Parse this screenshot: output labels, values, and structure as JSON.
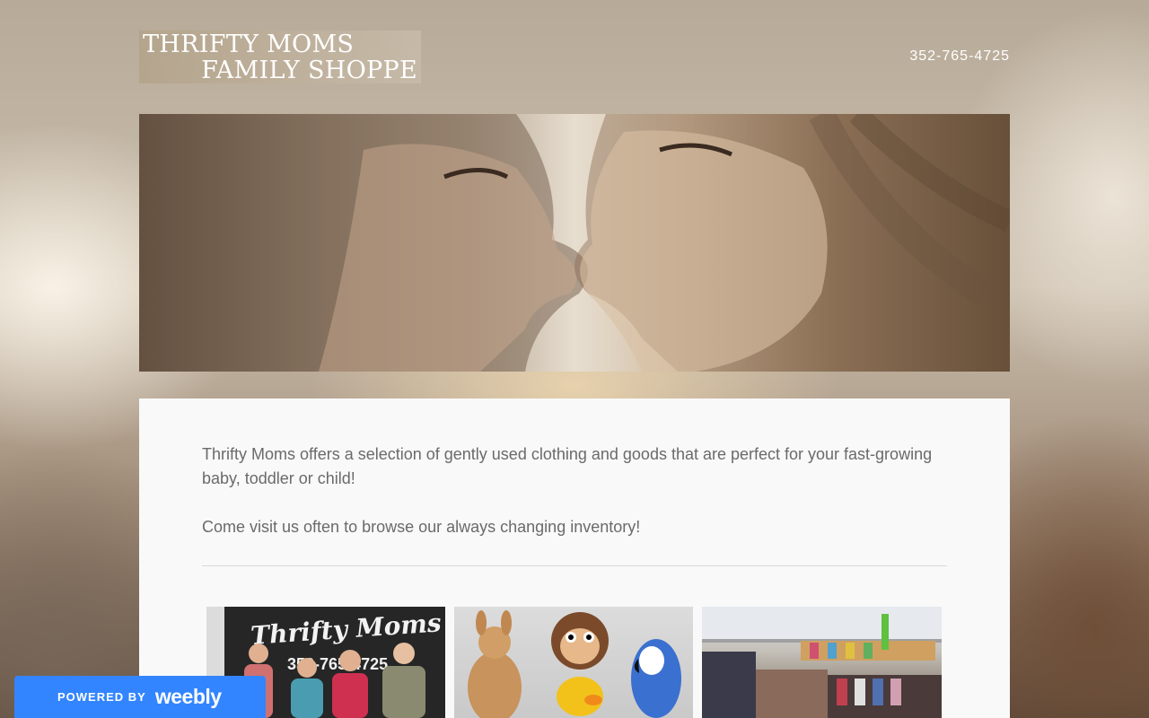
{
  "header": {
    "logo_line1": "THRIFTY MOMS",
    "logo_line2": "FAMILY SHOPPE",
    "phone": "352-765-4725"
  },
  "intro": {
    "paragraph1": "Thrifty Moms offers a selection of gently used clothing and goods that are perfect for your fast-growing baby, toddler or child!",
    "paragraph2": "Come visit us often to browse our always changing inventory!"
  },
  "gallery": {
    "storefront_sign": "Thrifty Moms",
    "storefront_phone": "352-765-4725"
  },
  "footer_badge": {
    "powered_by": "POWERED BY",
    "brand": "weebly"
  }
}
